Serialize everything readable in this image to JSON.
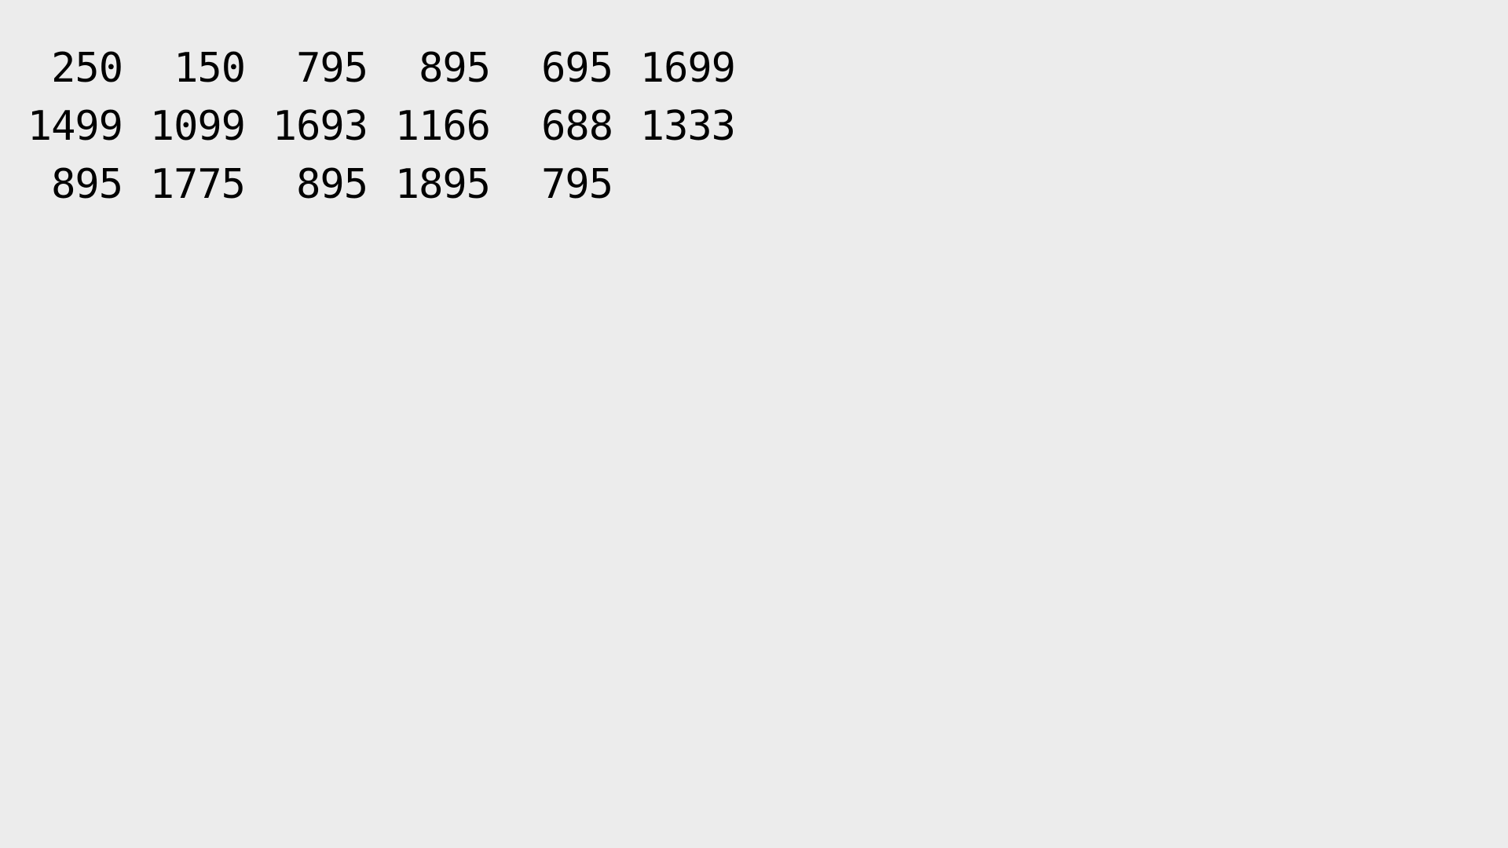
{
  "output": {
    "rows": [
      [
        "250",
        "150",
        "795",
        "895",
        "695",
        "1699"
      ],
      [
        "1499",
        "1099",
        "1693",
        "1166",
        "688",
        "1333"
      ],
      [
        "895",
        "1775",
        "895",
        "1895",
        "795"
      ]
    ]
  }
}
